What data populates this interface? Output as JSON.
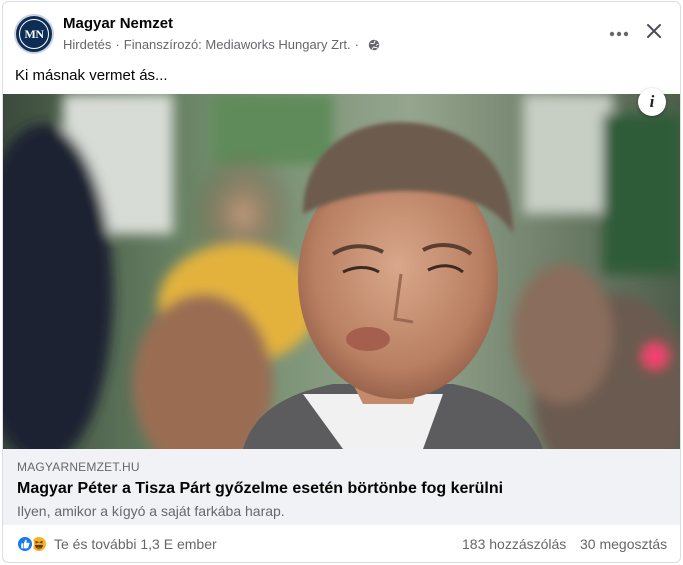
{
  "post": {
    "page_name": "Magyar Nemzet",
    "avatar_initials": "MN",
    "meta": {
      "sponsored_label": "Hirdetés",
      "separator": "·",
      "funded_by": "Finanszírozó: Mediaworks Hungary Zrt.",
      "separator2": "·",
      "audience_icon": "globe-icon"
    },
    "more_icon": "more-horizontal-icon",
    "close_icon": "close-icon",
    "caption": "Ki másnak vermet ás..."
  },
  "image": {
    "description_icon": "info-icon",
    "info_label": "i"
  },
  "link_preview": {
    "domain": "MAGYARNEMZET.HU",
    "title": "Magyar Péter a Tisza Párt győzelme esetén börtönbe fog kerülni",
    "description": "Ilyen, amikor a kígyó a saját farkába harap."
  },
  "footer": {
    "reaction_icons": [
      "like-icon",
      "haha-icon"
    ],
    "reactions_text": "Te és további 1,3 E ember",
    "comments": "183 hozzászólás",
    "shares": "30 megosztás"
  },
  "colors": {
    "accent": "#1877f2",
    "secondary_text": "#65676b",
    "preview_bg": "#f0f2f5",
    "avatar_bg": "#0d2d57"
  }
}
